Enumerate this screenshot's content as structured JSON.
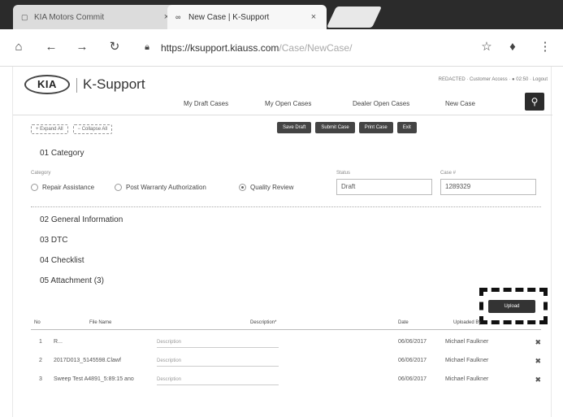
{
  "browser": {
    "tabs": [
      {
        "title": "KIA Motors Commit",
        "active": false,
        "favicon": "page-icon"
      },
      {
        "title": "New Case | K-Support",
        "active": true,
        "favicon": "kia-icon"
      }
    ],
    "url_host": "https://ksupport.kiauss.com",
    "url_path": "/Case/NewCase/",
    "icons": [
      "home-icon",
      "back-icon",
      "forward-icon",
      "reload-icon",
      "lock-icon",
      "star-icon",
      "microphone-icon",
      "menu-icon"
    ]
  },
  "header": {
    "logo": "KIA",
    "app_name": "K-Support",
    "user_line": "REDACTED · Customer Access · ● 02:50 · Logout",
    "nav": [
      "My Draft Cases",
      "My Open Cases",
      "Dealer Open Cases",
      "New Case"
    ]
  },
  "toolbar": {
    "expand_all": "+ Expand All",
    "collapse_all": "− Collapse All",
    "actions": [
      "Save Draft",
      "Submit Case",
      "Print Case",
      "Exit"
    ]
  },
  "sections": {
    "category": "01 Category",
    "general": "02 General Information",
    "dtc": "03 DTC",
    "checklist": "04 Checklist",
    "attachment": "05 Attachment (3)"
  },
  "category": {
    "label": "Category",
    "options": [
      {
        "label": "Repair Assistance",
        "selected": false
      },
      {
        "label": "Post Warranty Authorization",
        "selected": false
      },
      {
        "label": "Quality Review",
        "selected": true
      }
    ],
    "status_label": "Status",
    "status_value": "Draft",
    "case_label": "Case #",
    "case_value": "1289329"
  },
  "attachments": {
    "upload_label": "Upload",
    "columns": [
      "No",
      "File Name",
      "Description*",
      "Date",
      "Uploaded By"
    ],
    "rows": [
      {
        "no": "1",
        "file": "R...",
        "desc": "Description",
        "date": "06/06/2017",
        "by": "Michael Faulkner"
      },
      {
        "no": "2",
        "file": "2017D013_5145598.Clawf",
        "desc": "Description",
        "date": "06/06/2017",
        "by": "Michael Faulkner"
      },
      {
        "no": "3",
        "file": "Sweep Test A4891_5:89:15 ano",
        "desc": "Description",
        "date": "06/06/2017",
        "by": "Michael Faulkner"
      }
    ]
  }
}
